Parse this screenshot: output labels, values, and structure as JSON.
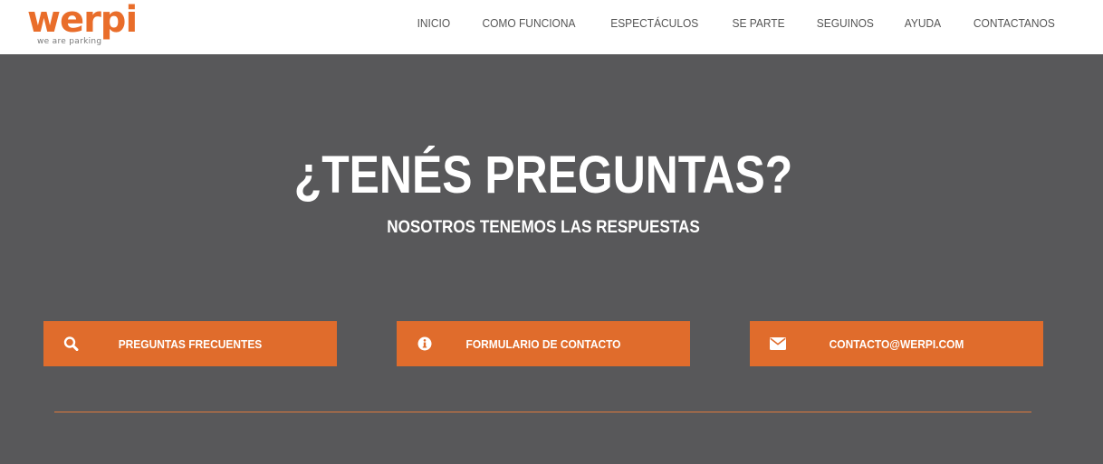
{
  "brand": {
    "name": "werpi",
    "tagline": "we are parking",
    "accent_color": "#e96d2a"
  },
  "nav": {
    "items": [
      {
        "label": "INICIO"
      },
      {
        "label": "COMO FUNCIONA"
      },
      {
        "label": "ESPECTÁCULOS"
      },
      {
        "label": "SE PARTE"
      },
      {
        "label": "SEGUINOS"
      },
      {
        "label": "AYUDA"
      },
      {
        "label": "CONTACTANOS"
      }
    ]
  },
  "hero": {
    "title": "¿TENÉS PREGUNTAS?",
    "subtitle": "NOSOTROS TENEMOS LAS RESPUESTAS",
    "background_color": "#58585a"
  },
  "actions": [
    {
      "label": "PREGUNTAS FRECUENTES",
      "icon": "search-icon"
    },
    {
      "label": "FORMULARIO DE CONTACTO",
      "icon": "info-icon"
    },
    {
      "label": "CONTACTO@WERPI.COM",
      "icon": "envelope-icon"
    }
  ],
  "colors": {
    "button": "#e06c2c",
    "divider": "#e07a3c"
  }
}
